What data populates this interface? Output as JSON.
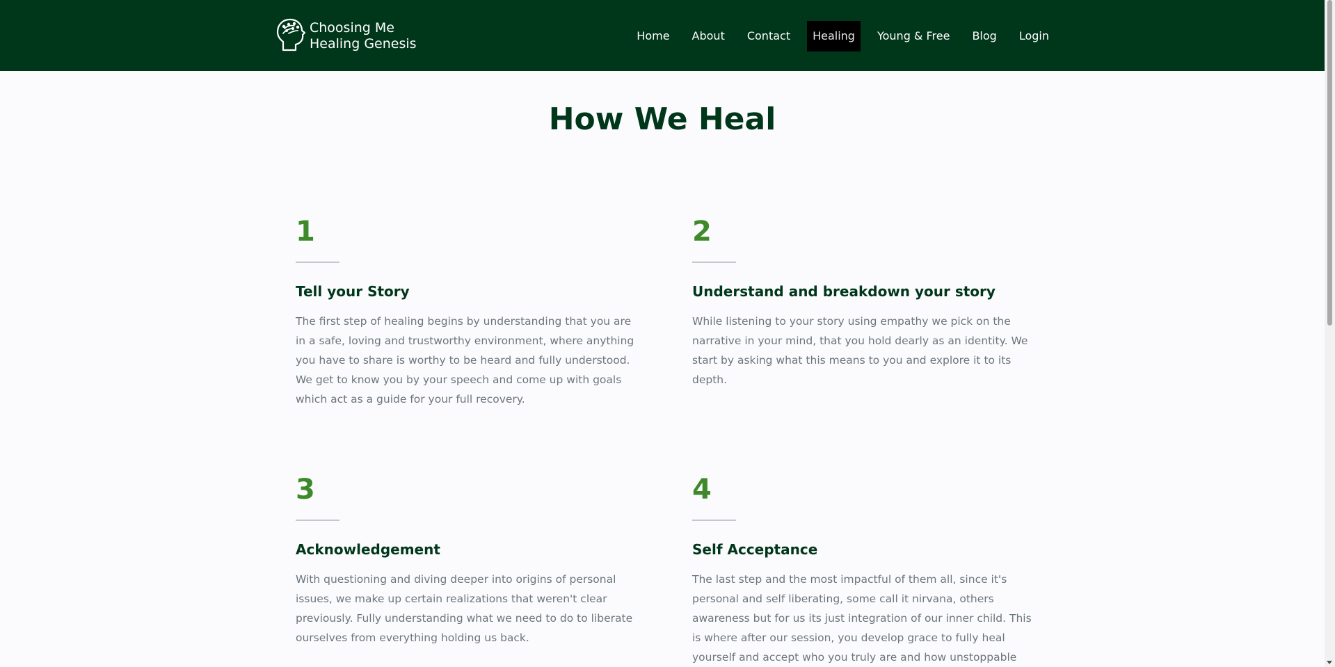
{
  "brand": {
    "line1": "Choosing Me",
    "line2": "Healing Genesis"
  },
  "nav": {
    "items": [
      {
        "label": "Home"
      },
      {
        "label": "About"
      },
      {
        "label": "Contact"
      },
      {
        "label": "Healing",
        "active": true
      },
      {
        "label": "Young & Free"
      },
      {
        "label": "Blog"
      },
      {
        "label": "Login"
      }
    ]
  },
  "page": {
    "title": "How We Heal"
  },
  "steps": [
    {
      "number": "1",
      "title": "Tell your Story",
      "body": "The first step of healing begins by understanding that you are in a safe, loving and trustworthy environment, where anything you have to share is worthy to be heard and fully understood. We get to know you by your speech and come up with goals which act as a guide for your full recovery."
    },
    {
      "number": "2",
      "title": "Understand and breakdown your story",
      "body": "While listening to your story using empathy we pick on the narrative in your mind, that you hold dearly as an identity. We start by asking what this means to you and explore it to its depth."
    },
    {
      "number": "3",
      "title": "Acknowledgement",
      "body": "With questioning and diving deeper into origins of personal issues, we make up certain realizations that weren't clear previously. Fully understanding what we need to do to liberate ourselves from everything holding us back."
    },
    {
      "number": "4",
      "title": "Self Acceptance",
      "body": "The last step and the most impactful of them all, since it's personal and self liberating, some call it nirvana, others awareness but for us its just integration of our inner child. This is where after our session, you develop grace to fully heal yourself and accept who you truly are and how unstoppable and great"
    }
  ],
  "colors": {
    "nav_bg": "#00361a",
    "accent_green": "#3e8a2b",
    "heading": "#00361a",
    "body_text": "#6c757d",
    "active_nav_bg": "#000000"
  },
  "icons": {
    "brand_logo": "head-with-leaves-icon"
  }
}
